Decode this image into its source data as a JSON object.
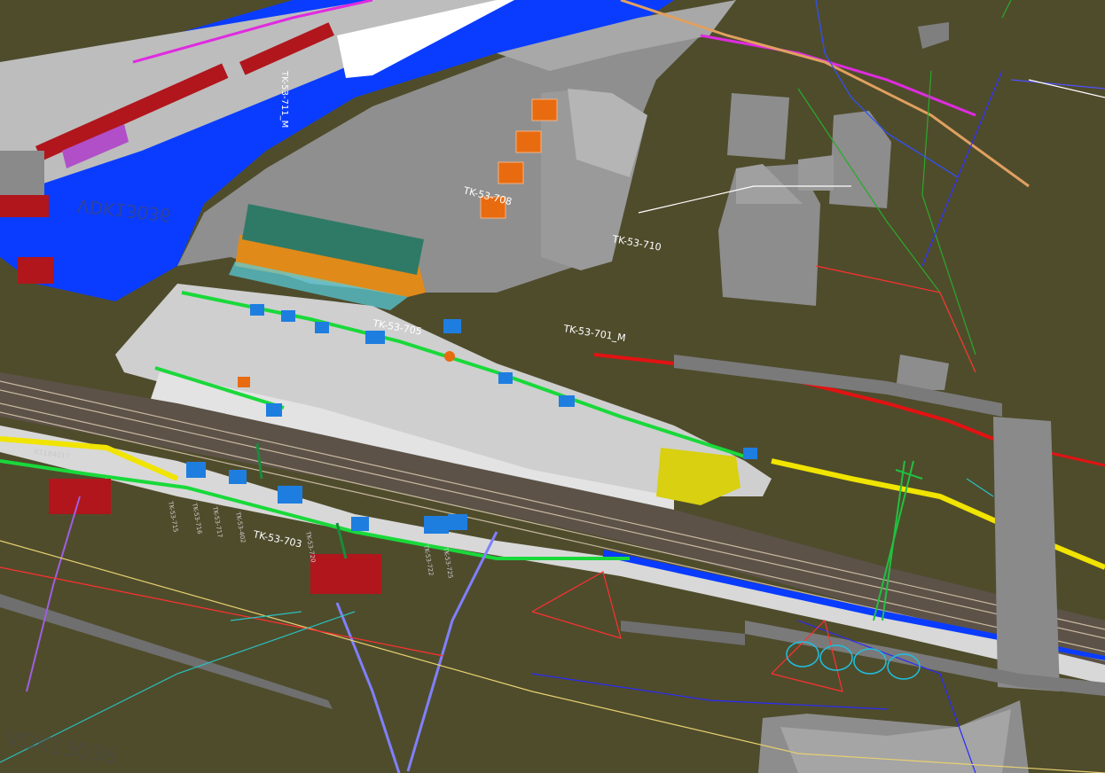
{
  "scene": {
    "background": "#4f4c2c",
    "colors": {
      "ground": "#4f4c2c",
      "water": "#0a3cff",
      "concrete": "#c4c4c4",
      "building": "#9a9a9a",
      "roof_green": "#2f7a66",
      "roof_orange": "#e08a1a",
      "cable_red": "#e31212",
      "cable_green": "#19d93a",
      "cable_yellow": "#f0e400",
      "cable_magenta": "#e02be0",
      "marker_blue": "#1e7ee0",
      "track": "#6b5a4a",
      "fence_red": "#b0161c"
    },
    "labels": {
      "tk_708": "TK-53-708",
      "tk_710": "TK-53-710",
      "tk_705": "TK-53-705",
      "tk_701m": "TK-53-701_M",
      "tk_703": "TK-53-703",
      "tk_711m": "TK-53-711_M",
      "vdk_top": "VDK13036",
      "vdk_bottom": "VDK13036",
      "k_label": "K1184017",
      "small_715": "TK-53-715",
      "small_716": "TK-53-716",
      "small_717": "TK-53-717",
      "small_402": "TK-53-402",
      "small_720": "TK-53-720",
      "small_722": "TK-53-722",
      "small_725": "TK-53-725"
    }
  }
}
